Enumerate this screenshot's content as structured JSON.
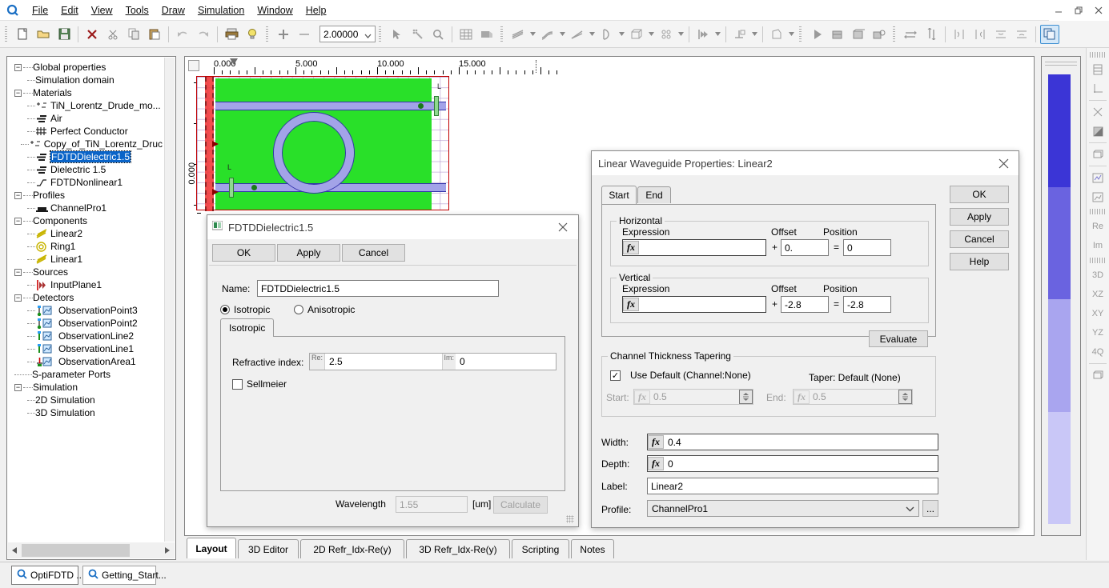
{
  "window": {
    "minimize": "—",
    "restore": "❐",
    "close": "✕"
  },
  "menu": {
    "items": [
      {
        "label": "File"
      },
      {
        "label": "Edit"
      },
      {
        "label": "View"
      },
      {
        "label": "Tools"
      },
      {
        "label": "Draw"
      },
      {
        "label": "Simulation"
      },
      {
        "label": "Window"
      },
      {
        "label": "Help"
      }
    ]
  },
  "toolbar": {
    "zoom_value": "2.00000",
    "icons": [
      "new-file-icon",
      "open-folder-icon",
      "save-disk-icon",
      "delete-x-icon",
      "cut-scissors-icon",
      "copy-icon",
      "paste-icon",
      "undo-icon",
      "redo-icon",
      "print-icon",
      "help-bulb-icon",
      "zoom-in-plus-icon",
      "zoom-out-minus-icon",
      "select-arrow-icon",
      "wand-select-icon",
      "magnifier-icon",
      "grid-icon",
      "fill-region-icon",
      "linear-waveguide-icon",
      "sbend-waveguide-icon",
      "taper-waveguide-icon",
      "arc-waveguide-icon",
      "cube-3d-icon",
      "ring-array-icon",
      "input-plane-icon",
      "detector-icon",
      "polygon-icon",
      "run-play-icon",
      "simulate-2d-icon",
      "simulate-3d-icon",
      "analyze-icon",
      "swap-horizontal-icon",
      "swap-vertical-icon",
      "align-left-icon",
      "align-right-icon",
      "align-top-icon",
      "align-bottom-icon",
      "copy-window-icon"
    ]
  },
  "tree": {
    "nodes": [
      {
        "label": "Global properties",
        "depth": 0,
        "expander": "minus",
        "icon": "none"
      },
      {
        "label": "Simulation domain",
        "depth": 1,
        "expander": "none",
        "icon": "none"
      },
      {
        "label": "Materials",
        "depth": 0,
        "expander": "minus",
        "icon": "none"
      },
      {
        "label": "TiN_Lorentz_Drude_mo...",
        "depth": 1,
        "expander": "none",
        "icon": "lorentz-drude-icon"
      },
      {
        "label": "Air",
        "depth": 1,
        "expander": "none",
        "icon": "dielectric-icon"
      },
      {
        "label": "Perfect Conductor",
        "depth": 1,
        "expander": "none",
        "icon": "conductor-icon"
      },
      {
        "label": "Copy_of_TiN_Lorentz_Druc",
        "depth": 1,
        "expander": "none",
        "icon": "lorentz-drude-icon"
      },
      {
        "label": "FDTDDielectric1.5",
        "depth": 1,
        "expander": "none",
        "icon": "dielectric-icon",
        "selected": true
      },
      {
        "label": "Dielectric 1.5",
        "depth": 1,
        "expander": "none",
        "icon": "dielectric-icon"
      },
      {
        "label": "FDTDNonlinear1",
        "depth": 1,
        "expander": "none",
        "icon": "nonlinear-icon"
      },
      {
        "label": "Profiles",
        "depth": 0,
        "expander": "minus",
        "icon": "none"
      },
      {
        "label": "ChannelPro1",
        "depth": 1,
        "expander": "none",
        "icon": "channel-profile-icon"
      },
      {
        "label": "Components",
        "depth": 0,
        "expander": "minus",
        "icon": "none"
      },
      {
        "label": "Linear2",
        "depth": 1,
        "expander": "none",
        "icon": "linear-waveguide-icon"
      },
      {
        "label": "Ring1",
        "depth": 1,
        "expander": "none",
        "icon": "ring-icon"
      },
      {
        "label": "Linear1",
        "depth": 1,
        "expander": "none",
        "icon": "linear-waveguide-icon"
      },
      {
        "label": "Sources",
        "depth": 0,
        "expander": "minus",
        "icon": "none"
      },
      {
        "label": "InputPlane1",
        "depth": 1,
        "expander": "none",
        "icon": "input-plane-icon"
      },
      {
        "label": "Detectors",
        "depth": 0,
        "expander": "minus",
        "icon": "none"
      },
      {
        "label": "ObservationPoint3",
        "depth": 1,
        "expander": "none",
        "icon": "observation-point-icon"
      },
      {
        "label": "ObservationPoint2",
        "depth": 1,
        "expander": "none",
        "icon": "observation-point-icon"
      },
      {
        "label": "ObservationLine2",
        "depth": 1,
        "expander": "none",
        "icon": "observation-line-icon"
      },
      {
        "label": "ObservationLine1",
        "depth": 1,
        "expander": "none",
        "icon": "observation-line-icon"
      },
      {
        "label": "ObservationArea1",
        "depth": 1,
        "expander": "none",
        "icon": "observation-area-icon"
      },
      {
        "label": "S-parameter Ports",
        "depth": 0,
        "expander": "none",
        "icon": "none"
      },
      {
        "label": "Simulation",
        "depth": 0,
        "expander": "minus",
        "icon": "none"
      },
      {
        "label": "2D Simulation",
        "depth": 1,
        "expander": "none",
        "icon": "none"
      },
      {
        "label": "3D Simulation",
        "depth": 1,
        "expander": "none",
        "icon": "none"
      }
    ]
  },
  "canvas": {
    "ruler_h_labels": [
      "0.000",
      "5.000",
      "10.000",
      "15.000"
    ],
    "ruler_v_labels": [
      "0.000"
    ],
    "marker_label": "L",
    "colors": {
      "wafer_green": "#29e029",
      "waveguide_purple": "#a3a3e8",
      "pml_red": "#f03030",
      "domain_border": "#c00000"
    }
  },
  "legend": {
    "segments": [
      "#3b35d6",
      "#6a63e0",
      "#a9a5ef",
      "#c9c7f7"
    ]
  },
  "vtoolbar": {
    "items": [
      {
        "icon": "layers-panel-icon",
        "label": ""
      },
      {
        "icon": "axes-icon",
        "label": ""
      },
      {
        "icon": "mesh-refine-icon",
        "label": ""
      },
      {
        "icon": "contrast-icon",
        "label": ""
      },
      {
        "icon": "box-view-icon",
        "label": ""
      },
      {
        "icon": "graph-up-icon",
        "label": ""
      },
      {
        "icon": "graph-area-icon",
        "label": ""
      },
      {
        "icon": "real-part-icon",
        "label": "Re"
      },
      {
        "icon": "imag-part-icon",
        "label": "Im"
      },
      {
        "icon": "view-3d-icon",
        "label": "3D"
      },
      {
        "icon": "view-xz-icon",
        "label": "XZ"
      },
      {
        "icon": "view-xy-icon",
        "label": "XY"
      },
      {
        "icon": "view-yz-icon",
        "label": "YZ"
      },
      {
        "icon": "view-4q-icon",
        "label": "4Q"
      },
      {
        "icon": "box-view2-icon",
        "label": ""
      }
    ]
  },
  "view_tabs": {
    "tabs": [
      {
        "label": "Layout",
        "active": true
      },
      {
        "label": "3D Editor",
        "active": false
      },
      {
        "label": "2D Refr_Idx-Re(y)",
        "active": false
      },
      {
        "label": "3D Refr_Idx-Re(y)",
        "active": false
      },
      {
        "label": "Scripting",
        "active": false
      },
      {
        "label": "Notes",
        "active": false
      }
    ]
  },
  "taskbar": {
    "buttons": [
      {
        "label": "OptiFDTD ...",
        "icon": "optifdtd-icon"
      },
      {
        "label": "Getting_Start...",
        "icon": "optifdtd-icon"
      }
    ]
  },
  "material_dialog": {
    "title": "FDTDDielectric1.5",
    "close": "✕",
    "buttons": {
      "ok": "OK",
      "apply": "Apply",
      "cancel": "Cancel"
    },
    "name_label": "Name:",
    "name_value": "FDTDDielectric1.5",
    "isotropic_radio": "Isotropic",
    "anisotropic_radio": "Anisotropic",
    "tab_label": "Isotropic",
    "refractive_label": "Refractive index:",
    "re_label": "Re:",
    "re_value": "2.5",
    "im_label": "Im:",
    "im_value": "0",
    "sellmeier_label": "Sellmeier",
    "wavelength_label": "Wavelength",
    "wavelength_value": "1.55",
    "wavelength_units": "[um]",
    "calculate_button": "Calculate"
  },
  "waveguide_dialog": {
    "title": "Linear Waveguide Properties: Linear2",
    "close": "✕",
    "tabs": [
      {
        "label": "Start",
        "active": true
      },
      {
        "label": "End",
        "active": false
      }
    ],
    "horizontal": {
      "group_title": "Horizontal",
      "expression_label": "Expression",
      "expression_value": "",
      "plus": "+",
      "offset_label": "Offset",
      "offset_value": "0.",
      "equals": "=",
      "position_label": "Position",
      "position_value": "0"
    },
    "vertical": {
      "group_title": "Vertical",
      "expression_label": "Expression",
      "expression_value": "",
      "plus": "+",
      "offset_label": "Offset",
      "offset_value": "-2.8",
      "equals": "=",
      "position_label": "Position",
      "position_value": "-2.8"
    },
    "evaluate_button": "Evaluate",
    "tapering": {
      "group_title": "Channel Thickness Tapering",
      "use_default_label": "Use Default (Channel:None)",
      "use_default_checked": "✓",
      "taper_label": "Taper:  Default (None)",
      "start_label": "Start:",
      "start_value": "0.5",
      "end_label": "End:",
      "end_value": "0.5"
    },
    "width_label": "Width:",
    "width_value": "0.4",
    "depth_label": "Depth:",
    "depth_value": "0",
    "label_label": "Label:",
    "label_value": "Linear2",
    "profile_label": "Profile:",
    "profile_value": "ChannelPro1",
    "profile_more": "...",
    "buttons": {
      "ok": "OK",
      "apply": "Apply",
      "cancel": "Cancel",
      "help": "Help"
    }
  }
}
